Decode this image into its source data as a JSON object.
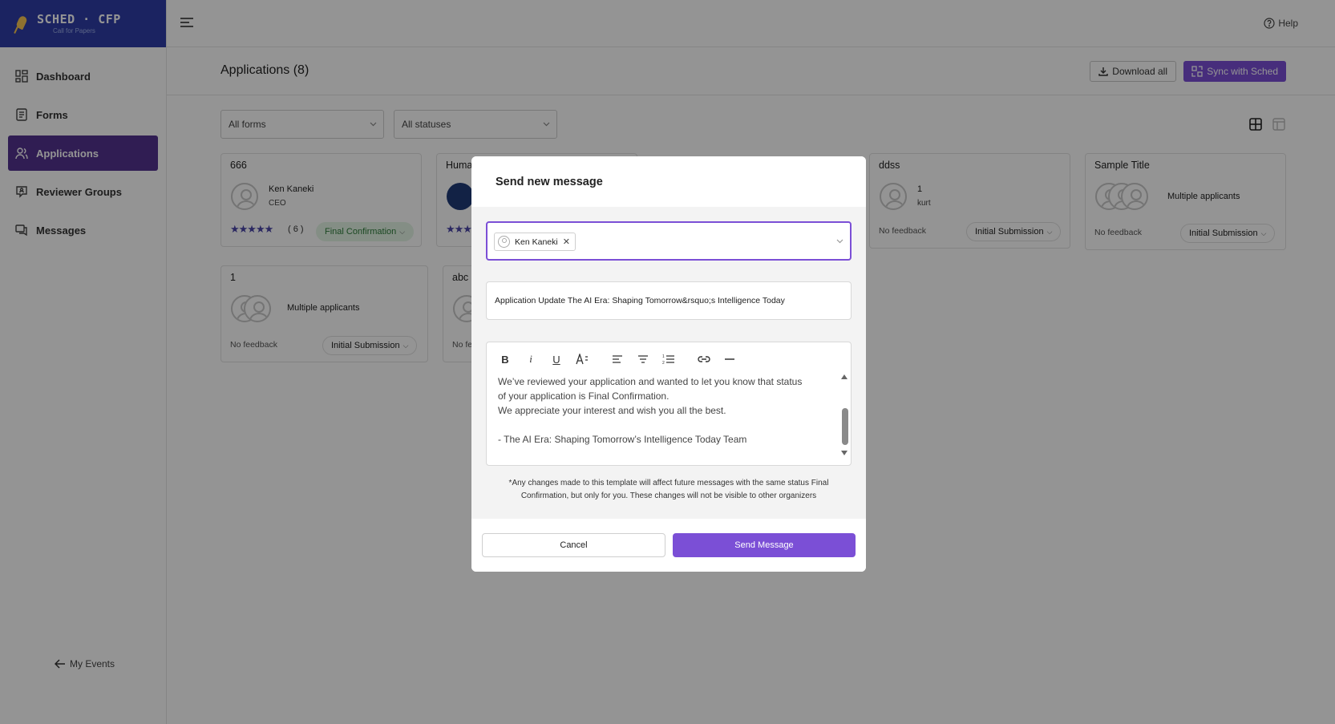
{
  "brand": {
    "title": "SCHED · CFP",
    "subtitle": "Call for Papers"
  },
  "sidebar": {
    "items": [
      {
        "label": "Dashboard",
        "icon": "dashboard-icon",
        "active": false
      },
      {
        "label": "Forms",
        "icon": "forms-icon",
        "active": false
      },
      {
        "label": "Applications",
        "icon": "applications-icon",
        "active": true
      },
      {
        "label": "Reviewer Groups",
        "icon": "reviewer-groups-icon",
        "active": false
      },
      {
        "label": "Messages",
        "icon": "messages-icon",
        "active": false
      }
    ],
    "my_events": "My Events"
  },
  "topbar": {
    "help": "Help"
  },
  "page": {
    "title": "Applications (8)",
    "download_all": "Download all",
    "sync": "Sync with Sched",
    "filters": {
      "forms": "All forms",
      "statuses": "All statuses"
    }
  },
  "cards": [
    {
      "title": "666",
      "name": "Ken Kaneki",
      "role": "CEO",
      "stars": "★★★★★",
      "stars_count": "( 6 )",
      "status": "Final Confirmation"
    },
    {
      "title": "Huma",
      "stars": "★★★"
    },
    {
      "title": "ddss",
      "name": "1",
      "role": "kurt",
      "feedback": "No feedback",
      "status": "Initial Submission"
    },
    {
      "title": "Sample Title",
      "name": "Multiple applicants",
      "feedback": "No feedback",
      "status": "Initial Submission"
    },
    {
      "title": "1",
      "name": "Multiple applicants",
      "feedback": "No feedback",
      "status": "Initial Submission"
    },
    {
      "title": "abc",
      "feedback": "No fe"
    }
  ],
  "modal": {
    "title": "Send new message",
    "recipient": "Ken Kaneki",
    "subject": "Application Update The AI Era: Shaping Tomorrow&rsquo;s Intelligence Today",
    "body": [
      "We’ve reviewed your application and wanted to let you know that status",
      "of your application is Final Confirmation.",
      "We appreciate your interest and wish you all the best.",
      "",
      "- The AI Era: Shaping Tomorrow’s Intelligence Today Team"
    ],
    "note": "*Any changes made to this template will affect future messages with the same status Final Confirmation, but only for you. These changes will not be visible to other organizers",
    "cancel": "Cancel",
    "send": "Send Message"
  },
  "colors": {
    "brand": "#2f3da8",
    "accent": "#7b4fd6",
    "active_nav": "#53338f",
    "status_green": "#e4f4e6"
  }
}
